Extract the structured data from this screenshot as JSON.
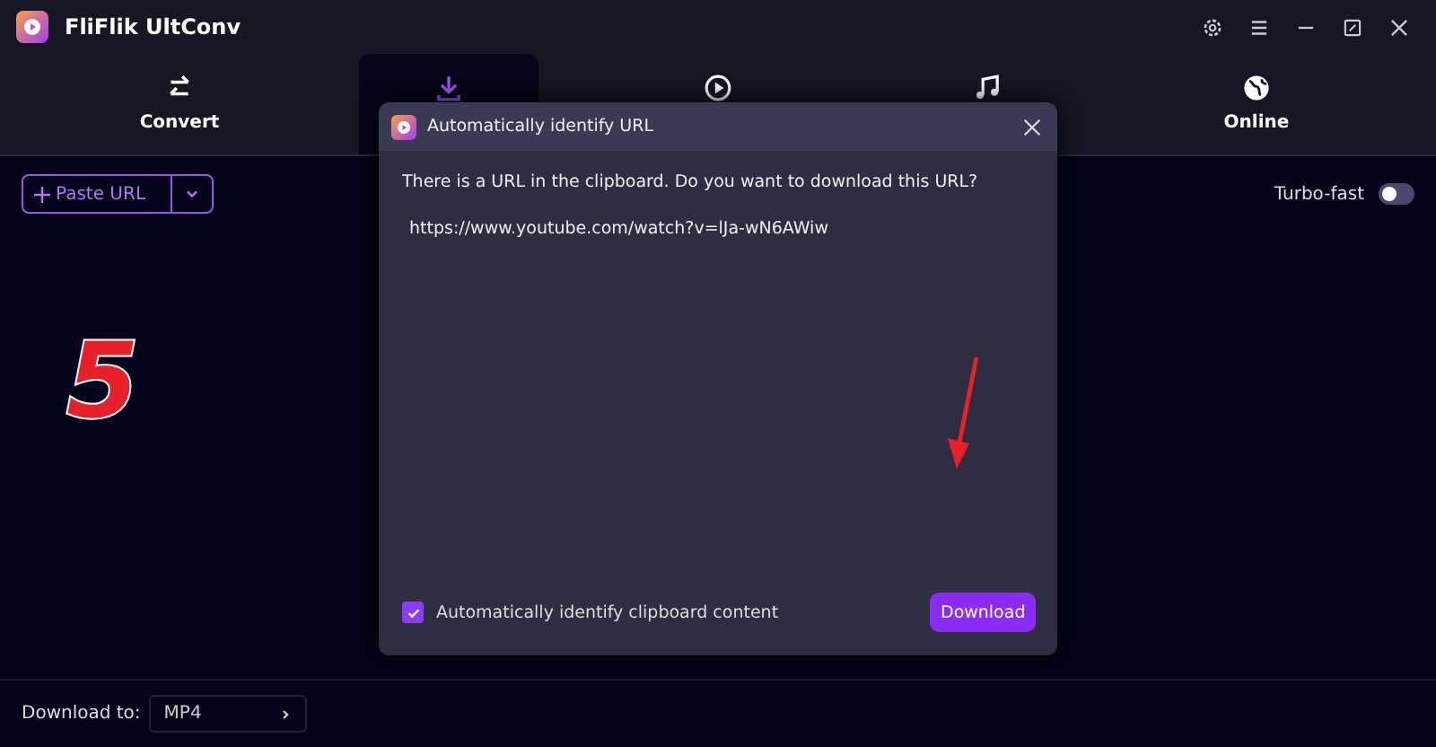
{
  "window": {
    "title": "FliFlik UltConv"
  },
  "tabs": [
    {
      "kind": "convert",
      "label": "Convert",
      "selected": false
    },
    {
      "kind": "download",
      "selected": true
    },
    {
      "kind": "play",
      "selected": false
    },
    {
      "kind": "music",
      "selected": false
    },
    {
      "kind": "online",
      "label": "Online",
      "selected": false
    }
  ],
  "toolbar": {
    "paste_button": "Paste URL",
    "turbo": {
      "label": "Turbo-fast",
      "on": false
    }
  },
  "annotation": {
    "step": "5"
  },
  "dialog": {
    "title": "Automatically identify URL",
    "message": "There is a URL in the clipboard. Do you want to download this URL?",
    "url": "https://www.youtube.com/watch?v=lJa-wN6AWiw",
    "checkbox": {
      "label": "Automatically identify clipboard content",
      "checked": true
    },
    "button": "Download"
  },
  "footer": {
    "label": "Download to:",
    "format": "MP4"
  }
}
